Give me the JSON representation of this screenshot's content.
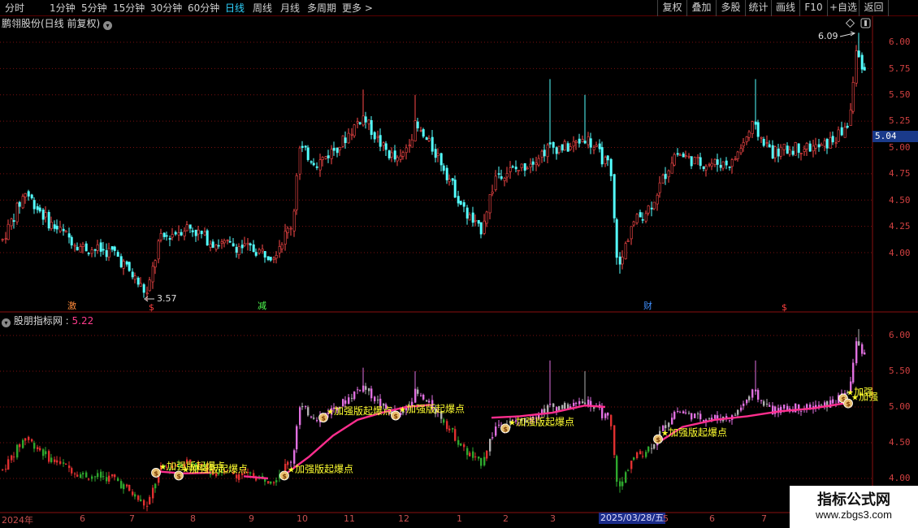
{
  "toolbar": {
    "periods": [
      "分时",
      "1分钟",
      "5分钟",
      "15分钟",
      "30分钟",
      "60分钟",
      "日线",
      "周线",
      "月线",
      "多周期",
      "更多"
    ],
    "active_period": "日线",
    "more_arrow": ">",
    "right_buttons": [
      "复权",
      "叠加",
      "多股",
      "统计",
      "画线",
      "F10",
      "+自选",
      "返回"
    ]
  },
  "main_panel": {
    "title": "鹏翎股份(日线 前复权)",
    "price_axis": [
      "6.00",
      "5.75",
      "5.50",
      "5.25",
      "5.00",
      "4.75",
      "4.50",
      "4.25",
      "4.00"
    ],
    "current_price": "5.04",
    "high_label": "6.09",
    "low_label": "3.57",
    "markers": [
      "激",
      "$",
      "减",
      "财",
      "$"
    ]
  },
  "indicator_panel": {
    "title": "股朋指标网",
    "value": "5.22",
    "value_color": "#ff3c8c",
    "price_axis": [
      "6.00",
      "5.50",
      "5.00",
      "4.50",
      "4.00"
    ],
    "signal_label": "加强版起爆点",
    "signal_label_short": "加强",
    "signal_icon": "money-bag-icon"
  },
  "date_axis": {
    "labels": [
      "2024年",
      "6",
      "7",
      "8",
      "9",
      "10",
      "11",
      "12",
      "1",
      "2",
      "3",
      "5",
      "6",
      "7"
    ],
    "current_date": "2025/03/28/五"
  },
  "watermark": {
    "title": "指标公式网",
    "url": "www.zbgs3.com"
  },
  "colors": {
    "up": "#ff4a4a",
    "down": "#54ffff",
    "grid": "#7a1010",
    "ma_line": "#ff2e8e",
    "signal_text": "#ffff30"
  }
}
